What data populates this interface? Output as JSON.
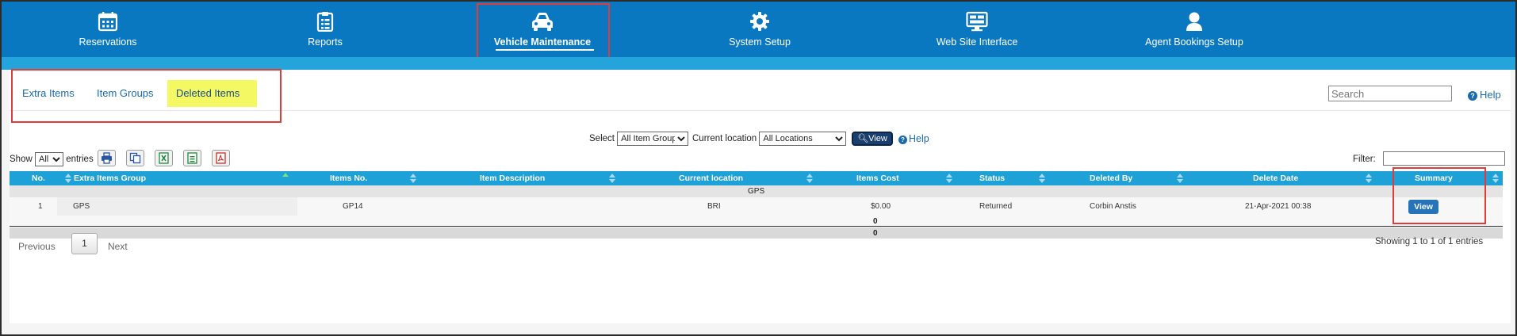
{
  "nav": {
    "items": [
      {
        "label": "Reservations",
        "icon": "calendar-icon"
      },
      {
        "label": "Reports",
        "icon": "clipboard-icon"
      },
      {
        "label": "Vehicle Maintenance",
        "icon": "car-icon"
      },
      {
        "label": "System Setup",
        "icon": "gear-icon"
      },
      {
        "label": "Web Site Interface",
        "icon": "monitor-icon"
      },
      {
        "label": "Agent Bookings Setup",
        "icon": "user-icon"
      }
    ],
    "active_index": 2,
    "colors": {
      "bar": "#0a78c0",
      "strip": "#24a4da"
    }
  },
  "tabs": [
    {
      "label": "Extra Items"
    },
    {
      "label": "Item Groups"
    },
    {
      "label": "Deleted Items"
    }
  ],
  "active_tab_index": 2,
  "search": {
    "placeholder": "Search",
    "value": ""
  },
  "help_label": "Help",
  "filters": {
    "select_label": "Select",
    "item_group_value": "All Item Group",
    "location_label": "Current location",
    "location_value": "All Locations",
    "view_label": "View",
    "help_label": "Help"
  },
  "entries": {
    "show_label": "Show",
    "value": "All",
    "entries_label": "entries"
  },
  "toolbar_icons": [
    "print-icon",
    "copy-icon",
    "excel-icon",
    "csv-icon",
    "pdf-icon"
  ],
  "filter_label": "Filter:",
  "table": {
    "columns": [
      "No.",
      "Extra Items Group",
      "Items No.",
      "Item Description",
      "Current location",
      "Items Cost",
      "Status",
      "Deleted By",
      "Delete Date",
      "Summary"
    ],
    "group_label": "GPS",
    "rows": [
      {
        "no": "1",
        "group": "GPS",
        "items_no": "GP14",
        "description": "",
        "location": "BRI",
        "cost": "$0.00",
        "status": "Returned",
        "deleted_by": "Corbin Anstis",
        "delete_date": "21-Apr-2021 00:38",
        "action": "View"
      }
    ],
    "subtotal": "0",
    "total": "0",
    "header_color": "#1ea1d7"
  },
  "pagination": {
    "previous": "Previous",
    "current": "1",
    "next": "Next",
    "summary": "Showing 1 to 1 of 1 entries"
  }
}
